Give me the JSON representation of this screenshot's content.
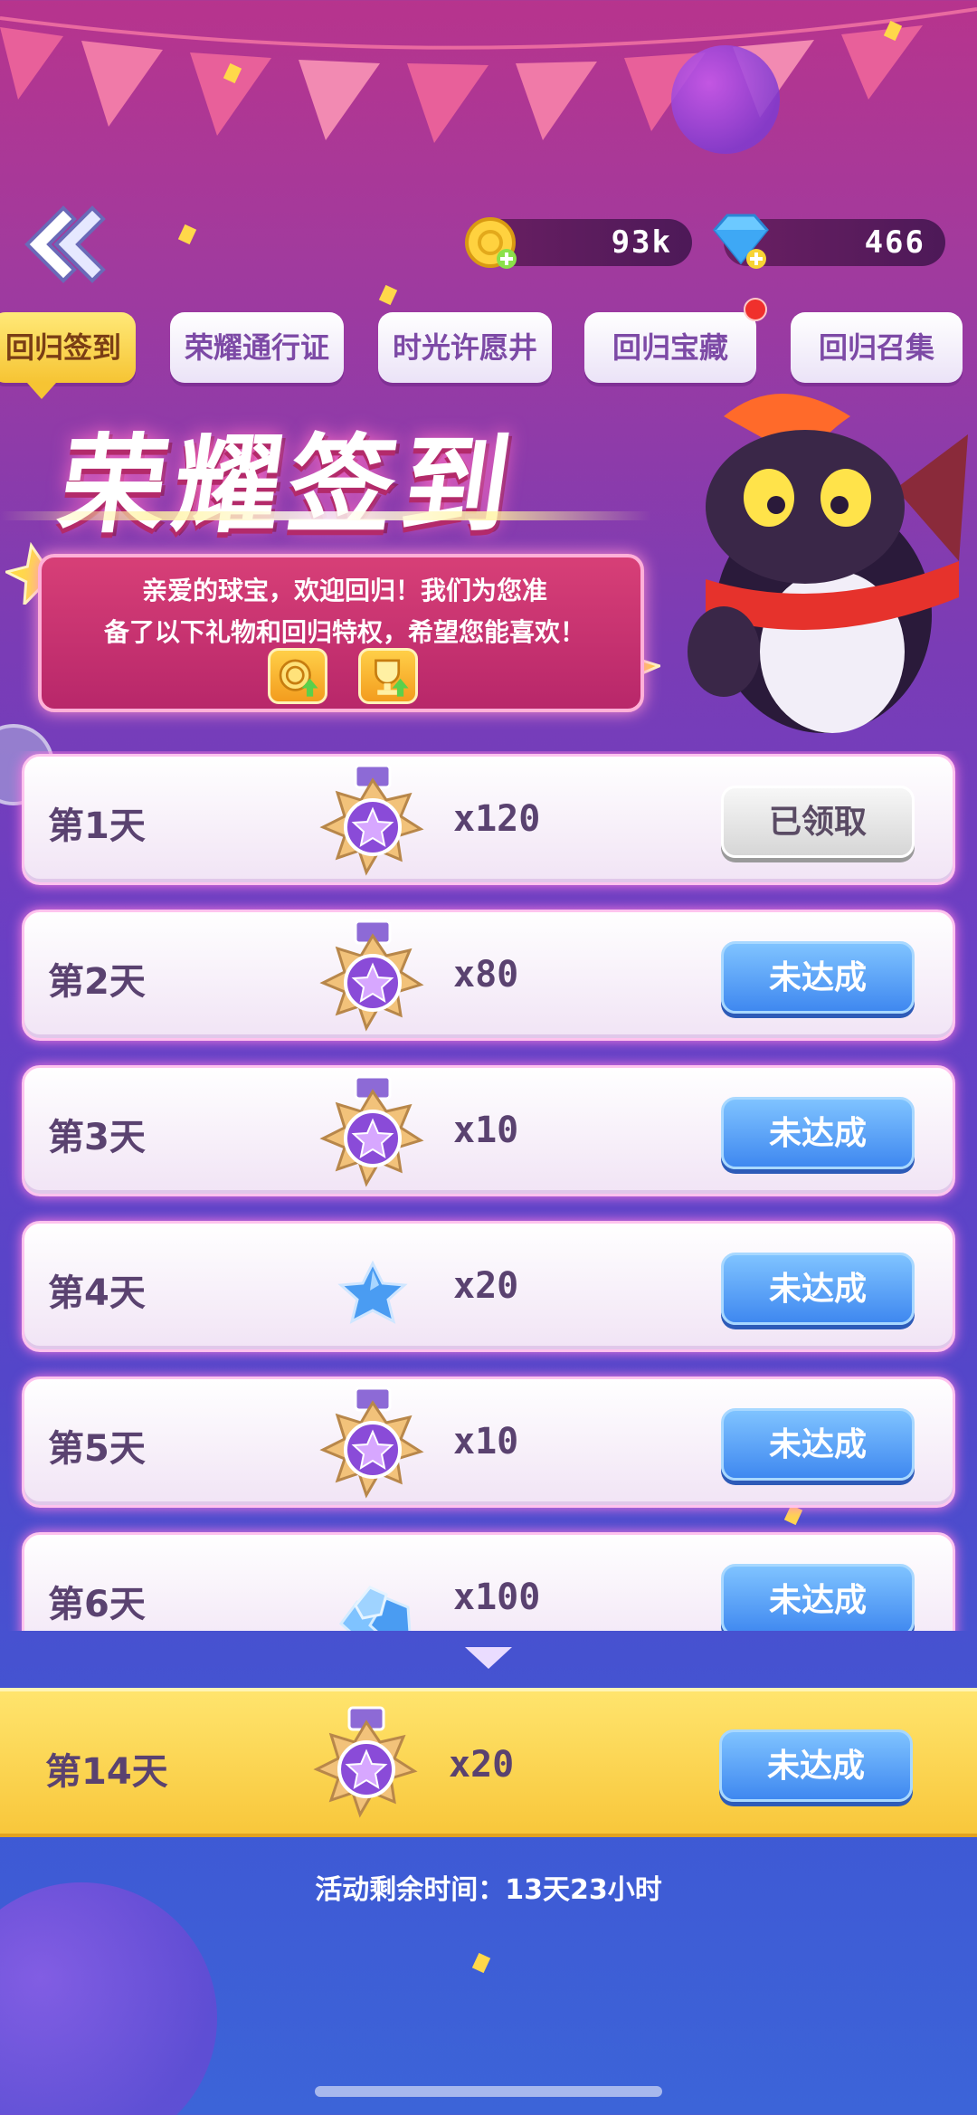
{
  "header": {
    "currencies": [
      {
        "name": "gold",
        "value": "93k"
      },
      {
        "name": "gem",
        "value": "466"
      }
    ]
  },
  "tabs": [
    {
      "label": "回归签到",
      "active": true
    },
    {
      "label": "荣耀通行证",
      "active": false
    },
    {
      "label": "时光许愿井",
      "active": false
    },
    {
      "label": "回归宝藏",
      "active": false,
      "badge": true
    },
    {
      "label": "回归召集",
      "active": false
    }
  ],
  "banner": {
    "title": "荣耀签到",
    "welcome_line1": "亲爱的球宝，欢迎回归！我们为您准",
    "welcome_line2": "备了以下礼物和回归特权，希望您能喜欢！"
  },
  "rows": [
    {
      "day": "第1天",
      "reward_icon": "star-medal-icon",
      "quantity": "x120",
      "status": "已领取",
      "claimed": true
    },
    {
      "day": "第2天",
      "reward_icon": "star-medal-icon",
      "quantity": "x80",
      "status": "未达成",
      "claimed": false
    },
    {
      "day": "第3天",
      "reward_icon": "star-medal-icon",
      "quantity": "x10",
      "status": "未达成",
      "claimed": false
    },
    {
      "day": "第4天",
      "reward_icon": "blue-star-icon",
      "quantity": "x20",
      "status": "未达成",
      "claimed": false
    },
    {
      "day": "第5天",
      "reward_icon": "star-medal-icon",
      "quantity": "x10",
      "status": "未达成",
      "claimed": false
    },
    {
      "day": "第6天",
      "reward_icon": "diamond-pile-icon",
      "quantity": "x100",
      "status": "未达成",
      "claimed": false
    }
  ],
  "final_reward": {
    "day": "第14天",
    "reward_icon": "star-medal-icon",
    "quantity": "x20",
    "status": "未达成"
  },
  "footer": {
    "remaining_time": "活动剩余时间：13天23小时"
  },
  "colors": {
    "active_tab": "#f6c433",
    "button_blue": "#3f88f0",
    "claimed_gray": "#d6d6d6",
    "row_glow": "#ff7be0"
  }
}
